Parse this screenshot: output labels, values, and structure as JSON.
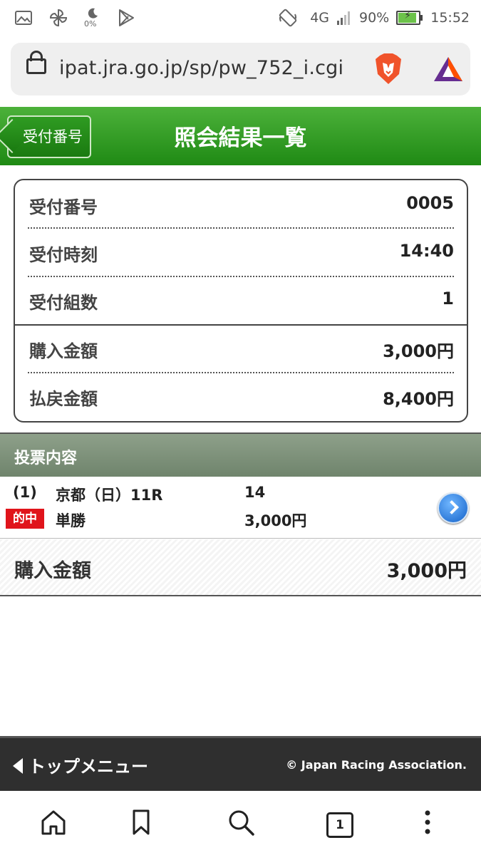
{
  "status_bar": {
    "network": "4G",
    "battery": "90%",
    "battery_level": 0.9,
    "time": "15:52",
    "data_saver_percent": "0%",
    "icons": [
      "gallery-icon",
      "pinwheel-icon",
      "moon-icon",
      "play-store-icon",
      "rotate-icon",
      "signal-icon",
      "battery-icon"
    ]
  },
  "browser": {
    "url": "ipat.jra.go.jp/sp/pw_752_i.cgi",
    "icons": [
      "lock-icon",
      "brave-lion-icon",
      "bat-triangle-icon"
    ]
  },
  "header": {
    "back_label": "受付番号",
    "title": "照会結果一覧",
    "color": "#2a961d"
  },
  "receipt": {
    "rows": [
      {
        "label": "受付番号",
        "value": "0005"
      },
      {
        "label": "受付時刻",
        "value": "14:40"
      },
      {
        "label": "受付組数",
        "value": "1"
      },
      {
        "label": "購入金額",
        "value": "3,000円"
      },
      {
        "label": "払戻金額",
        "value": "8,400円"
      }
    ]
  },
  "bets": {
    "section_title": "投票内容",
    "items": [
      {
        "index": "(1)",
        "race": "京都（日）11R",
        "horse": "14",
        "badge": "的中",
        "bet_type": "単勝",
        "amount": "3,000円"
      }
    ]
  },
  "total": {
    "label": "購入金額",
    "value": "3,000円"
  },
  "footer": {
    "menu_label": "トップメニュー",
    "copyright": "© Japan Racing Association."
  },
  "navbar": {
    "tab_count": "1",
    "icons": [
      "home-icon",
      "bookmark-icon",
      "search-icon",
      "tabs-icon",
      "more-vertical-icon"
    ]
  },
  "colors": {
    "badge": "#e0141b",
    "section_header": "#7e917a",
    "footer": "#2f2f2f"
  }
}
